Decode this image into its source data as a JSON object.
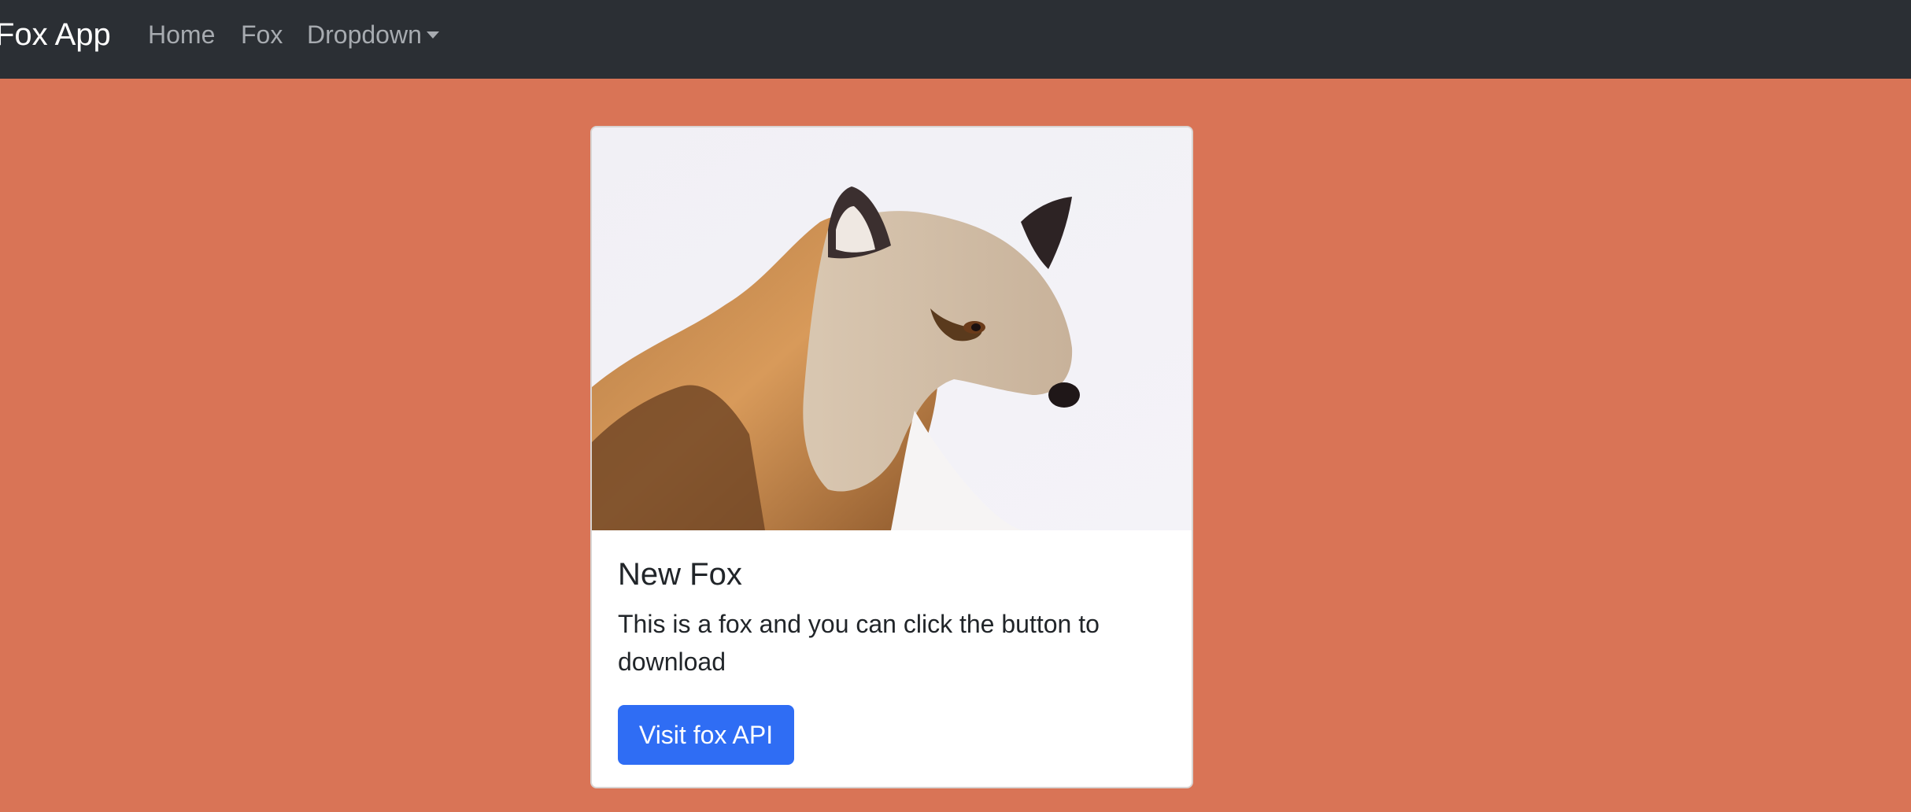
{
  "navbar": {
    "brand": "Fox App",
    "links": [
      "Home",
      "Fox",
      "Dropdown"
    ]
  },
  "card": {
    "image": "fox-photo",
    "title": "New Fox",
    "text": "This is a fox and you can click the button to download",
    "button_label": "Visit fox API"
  },
  "colors": {
    "page_background": "#d97456",
    "navbar_background": "#2b2f34",
    "button_primary": "#2f6df4"
  }
}
